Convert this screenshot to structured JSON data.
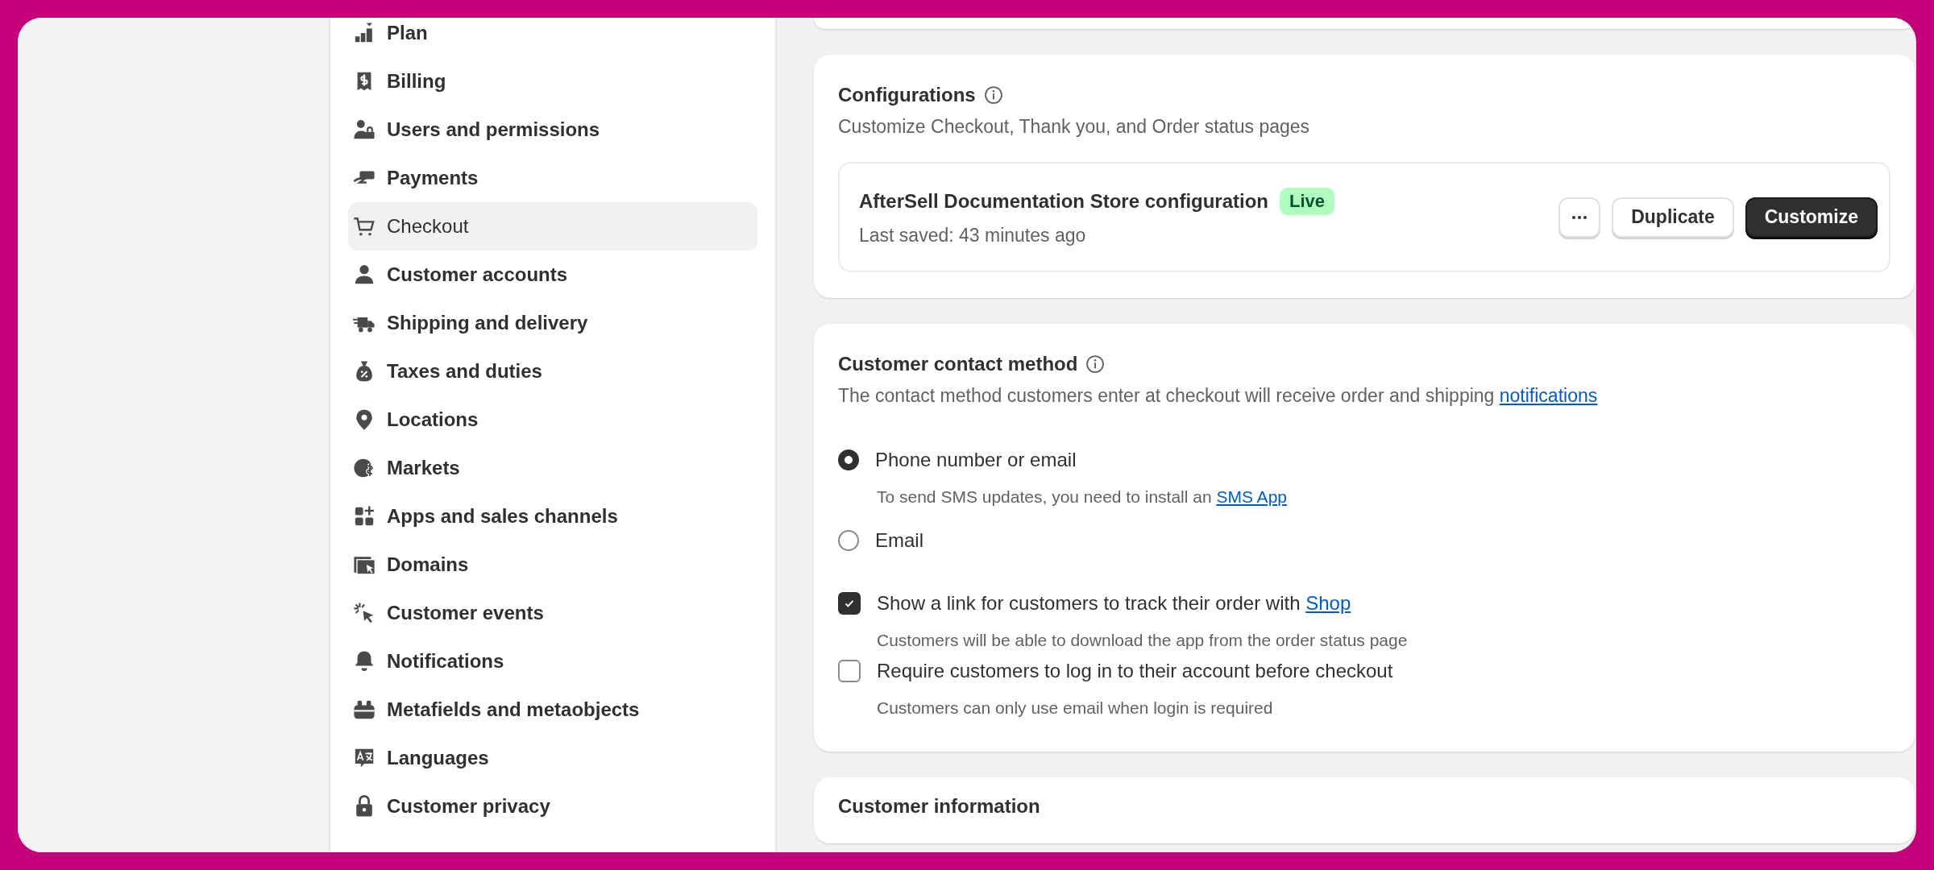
{
  "sidebar": {
    "items": [
      {
        "label": "Plan",
        "selected": false
      },
      {
        "label": "Billing",
        "selected": false
      },
      {
        "label": "Users and permissions",
        "selected": false
      },
      {
        "label": "Payments",
        "selected": false
      },
      {
        "label": "Checkout",
        "selected": true
      },
      {
        "label": "Customer accounts",
        "selected": false
      },
      {
        "label": "Shipping and delivery",
        "selected": false
      },
      {
        "label": "Taxes and duties",
        "selected": false
      },
      {
        "label": "Locations",
        "selected": false
      },
      {
        "label": "Markets",
        "selected": false
      },
      {
        "label": "Apps and sales channels",
        "selected": false
      },
      {
        "label": "Domains",
        "selected": false
      },
      {
        "label": "Customer events",
        "selected": false
      },
      {
        "label": "Notifications",
        "selected": false
      },
      {
        "label": "Metafields and metaobjects",
        "selected": false
      },
      {
        "label": "Languages",
        "selected": false
      },
      {
        "label": "Customer privacy",
        "selected": false
      }
    ]
  },
  "configurations": {
    "title": "Configurations",
    "subtitle": "Customize Checkout, Thank you, and Order status pages",
    "config": {
      "name": "AfterSell Documentation Store configuration",
      "badge": "Live",
      "last_saved": "Last saved: 43 minutes ago",
      "buttons": [
        {
          "label": "Duplicate",
          "kind": "secondary"
        },
        {
          "label": "Customize",
          "kind": "primary"
        }
      ]
    }
  },
  "contact_method": {
    "title": "Customer contact method",
    "description": "The contact method customers enter at checkout will receive order and shipping ",
    "description_link": "notifications",
    "options": [
      {
        "kind": "radio",
        "label": "Phone number or email",
        "selected": true,
        "help": "To send SMS updates, you need to install an ",
        "help_link": "SMS App"
      },
      {
        "kind": "radio",
        "label": "Email",
        "selected": false
      },
      {
        "kind": "checkbox",
        "label": "Show a link for customers to track their order with ",
        "link": "Shop",
        "checked": true,
        "help": "Customers will be able to download the app from the order status page"
      },
      {
        "kind": "checkbox",
        "label": "Require customers to log in to their account before checkout",
        "checked": false,
        "help": "Customers can only use email when login is required"
      }
    ]
  },
  "customer_information": {
    "title": "Customer information"
  }
}
